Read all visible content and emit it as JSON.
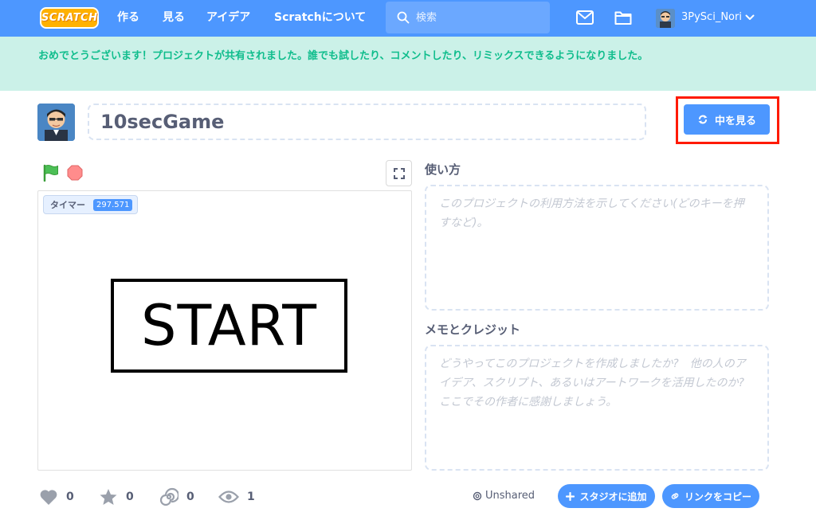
{
  "navbar": {
    "logo_text": "SCRATCH",
    "links": [
      "作る",
      "見る",
      "アイデア",
      "Scratchについて"
    ],
    "search_placeholder": "検索",
    "username": "3PySci_Nori",
    "icons": {
      "search": "search-icon",
      "messages": "mail-icon",
      "mystuff": "folder-icon",
      "menu": "chevron-down-icon"
    }
  },
  "banner": {
    "message": "おめでとうございます！プロジェクトが共有されました。誰でも試したり、コメントしたり、リミックスできるようになりました。"
  },
  "project": {
    "title": "10secGame",
    "see_inside_label": "中を見る"
  },
  "stage": {
    "monitor_label": "タイマー",
    "monitor_value": "297.571",
    "start_text": "START"
  },
  "instructions": {
    "label": "使い方",
    "placeholder": "このプロジェクトの利用方法を示してください(どのキーを押すなど)。"
  },
  "notes": {
    "label": "メモとクレジット",
    "placeholder": "どうやってこのプロジェクトを作成しましたか?　他の人のアイデア、スクリプト、あるいはアートワークを活用したのか?　ここでその作者に感謝しましょう。"
  },
  "stats": {
    "loves": "0",
    "favorites": "0",
    "remixes": "0",
    "views": "1"
  },
  "footer": {
    "unshared_label": "Unshared",
    "add_studio_label": "スタジオに追加",
    "copy_link_label": "リンクをコピー"
  },
  "colors": {
    "brand_blue": "#4d97ff",
    "banner_bg": "#cbf1e8",
    "banner_text": "#0fbd8c",
    "highlight_red": "#ff1a00"
  }
}
